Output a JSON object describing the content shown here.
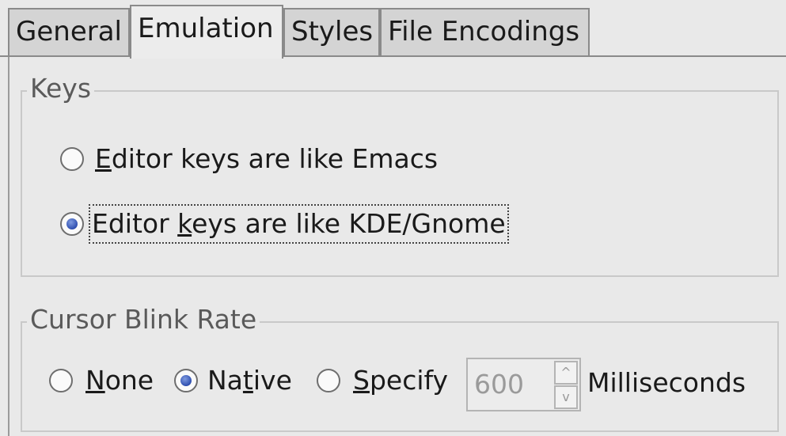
{
  "tabs": [
    {
      "label": "General",
      "active": false
    },
    {
      "label": "Emulation",
      "active": true
    },
    {
      "label": "Styles",
      "active": false
    },
    {
      "label": "File Encodings",
      "active": false
    }
  ],
  "keys": {
    "title": "Keys",
    "option_emacs": {
      "pre": "",
      "mnemonic": "E",
      "post": "ditor keys are like Emacs",
      "checked": false
    },
    "option_kde": {
      "pre": "Editor ",
      "mnemonic": "k",
      "post": "eys are like KDE/Gnome",
      "checked": true
    }
  },
  "cursor": {
    "title": "Cursor Blink Rate",
    "none": {
      "pre": "",
      "mnemonic": "N",
      "post": "one",
      "checked": false
    },
    "native": {
      "pre": "Na",
      "mnemonic": "t",
      "post": "ive",
      "checked": true
    },
    "specify": {
      "pre": "",
      "mnemonic": "S",
      "post": "pecify",
      "checked": false
    },
    "spin_value": "600",
    "spin_up_glyph": "^",
    "spin_down_glyph": "v",
    "unit_label": "Milliseconds"
  }
}
